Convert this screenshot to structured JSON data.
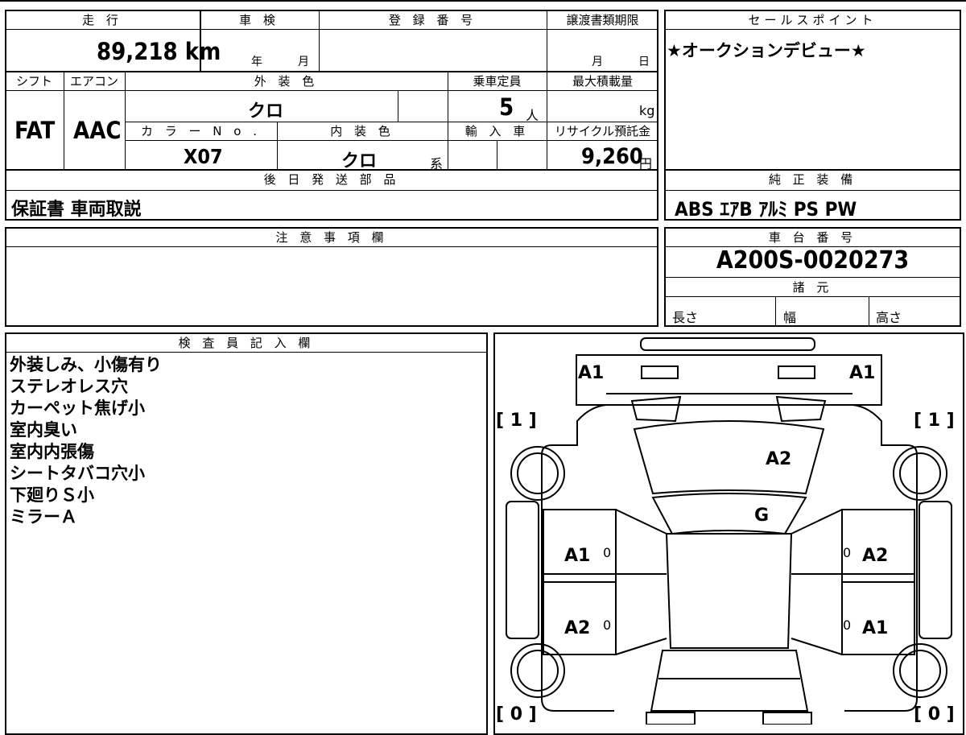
{
  "vehicle": {
    "mileage_label": "走 行",
    "mileage": "89,218 km",
    "inspection_label": "車 検",
    "inspection_year": "年",
    "inspection_month": "月",
    "reg_no_label": "登 録 番 号",
    "transfer_label": "譲渡書類期限",
    "transfer_month": "月",
    "transfer_day": "日",
    "shift_label": "シフト",
    "shift": "FAT",
    "ac_label": "エアコン",
    "ac": "AAC",
    "ext_color_label": "外 装 色",
    "ext_color": "クロ",
    "capacity_label": "乗車定員",
    "capacity": "5",
    "capacity_unit": "人",
    "max_load_label": "最大積載量",
    "max_load_unit": "kg",
    "color_no_label": "カ ラ ー N o .",
    "color_no": "X07",
    "int_color_label": "内 装 色",
    "int_color": "クロ",
    "int_color_suffix": "系",
    "import_label": "輸 入 車",
    "recycle_label": "リサイクル預託金",
    "recycle": "9,260",
    "recycle_unit": "円"
  },
  "later_parts": {
    "label": "後 日 発 送 部 品",
    "value": "保証書 車両取説"
  },
  "sales_point": {
    "label": "セールスポイント",
    "value": "★オークションデビュー★"
  },
  "genuine_equipment": {
    "label": "純 正 装 備",
    "value": "ABS ｴｱB ｱﾙﾐ PS PW"
  },
  "caution": {
    "label": "注 意 事 項 欄"
  },
  "chassis": {
    "label": "車 台 番 号",
    "value": "A200S-0020273"
  },
  "specs": {
    "label": "諸 元",
    "length": "長さ",
    "width": "幅",
    "height": "高さ"
  },
  "inspector": {
    "label": "検 査 員 記 入 欄",
    "notes": [
      "外装しみ、小傷有り",
      "ステレオレス穴",
      "カーペット焦げ小",
      "室内臭い",
      "室内内張傷",
      "シートタバコ穴小",
      "下廻りＳ小",
      "ミラーＡ"
    ]
  },
  "diagram": {
    "front_left_bumper": "A1",
    "front_right_bumper": "A1",
    "left_front_bracket": "[ 1 ]",
    "right_front_bracket": "[ 1 ]",
    "hood": "A2",
    "windshield": "G",
    "left_front_door": "A1",
    "right_front_door": "A2",
    "left_rear_door": "A2",
    "right_rear_door": "A1",
    "left_front_door_zero": "0",
    "right_front_door_zero": "0",
    "left_rear_door_zero": "0",
    "right_rear_door_zero": "0",
    "left_rear_bracket": "[ 0 ]",
    "right_rear_bracket": "[ 0 ]"
  }
}
